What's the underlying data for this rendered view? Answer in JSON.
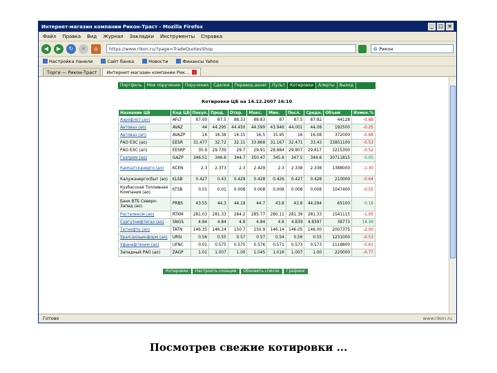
{
  "window": {
    "title": "Интернет-магазин компании Рикон-Траст - Mozilla Firefox",
    "controls": {
      "minimize": "_",
      "maximize": "□",
      "close": "×"
    }
  },
  "menu": [
    "Файл",
    "Правка",
    "Вид",
    "Журнал",
    "Закладки",
    "Инструменты",
    "Справка"
  ],
  "nav": {
    "url": "https://www.rikon.ru/?page=TradeQuotesShop",
    "search_engine": "G",
    "search_value": "Рикон"
  },
  "bookmarks": [
    "Настройка панели",
    "Сайт банка",
    "Новости",
    "Финансы Yahoo"
  ],
  "tabs": [
    {
      "label": "Торги — Рикон-Траст",
      "active": false
    },
    {
      "label": "Интернет-магазин компании Рик...",
      "active": true
    }
  ],
  "status": {
    "left": "Готово",
    "right": "www.rikon.ru"
  },
  "site": {
    "topnav": [
      "Портфель",
      "Мои поручения",
      "Поручения",
      "Сделки",
      "Перевод денег",
      "Пульт",
      "Котировки",
      "Алерты",
      "Выход"
    ],
    "active_tab": "Котировки",
    "quotes_title": "Котировки ЦБ на 14.12.2007 16:10",
    "columns": [
      "Название ЦБ",
      "Код ЦБ",
      "Покуп.",
      "Прод.",
      "Откр.",
      "Макс.",
      "Мин.",
      "Посл.",
      "Средн.",
      "Объем",
      "Измен.%"
    ],
    "rows": [
      {
        "name": "Аэрофлот (ао)",
        "code": "AFLT",
        "buy": "87.00",
        "sell": "87.5",
        "open": "88.33",
        "max": "88.83",
        "min": "87",
        "last": "87.5",
        "avg": "87.82",
        "vol": "44128",
        "chg": "-0.88",
        "link": true
      },
      {
        "name": "Автоваз (ао)",
        "code": "AVAZ",
        "buy": "44",
        "sell": "44.295",
        "open": "44.450",
        "max": "44.599",
        "min": "43.946",
        "last": "44.001",
        "avg": "44.08",
        "vol": "192500",
        "chg": "-0.25",
        "link": true
      },
      {
        "name": "Автоваз (ап)",
        "code": "AVAZP",
        "buy": "16",
        "sell": "16.38",
        "open": "16.15",
        "max": "16.5",
        "min": "15.95",
        "last": "16",
        "avg": "16.08",
        "vol": "372000",
        "chg": "-0.68",
        "link": true
      },
      {
        "name": "РАО ЕЭС (ао)",
        "code": "EESR",
        "buy": "31.477",
        "sell": "32.72",
        "open": "32.11",
        "max": "33.868",
        "min": "31.167",
        "last": "32.471",
        "avg": "33.43",
        "vol": "33851100",
        "chg": "-0.53",
        "link": false
      },
      {
        "name": "РАО ЕЭС (ап)",
        "code": "EESRP",
        "buy": "30.9",
        "sell": "29.739",
        "open": "29.7",
        "max": "29.91",
        "min": "28.884",
        "last": "29.807",
        "avg": "29.817",
        "vol": "3215300",
        "chg": "-0.52",
        "link": false
      },
      {
        "name": "Газпром (ао)",
        "code": "GAZP",
        "buy": "346.51",
        "sell": "346.6",
        "open": "344.7",
        "max": "350.47",
        "min": "345.8",
        "last": "347.5",
        "avg": "344.6",
        "vol": "30711815",
        "chg": "0.05",
        "link": true
      },
      {
        "name": "Камчатскэнерго (ао)",
        "code": "KCEN",
        "buy": "2.3",
        "sell": "2.373",
        "open": "2.3",
        "max": "2.429",
        "min": "2.3",
        "last": "2.338",
        "avg": "2.338",
        "vol": "1388000",
        "chg": "-1.30",
        "link": true,
        "tall": true
      },
      {
        "name": "Калужэнергосбыт (ао)",
        "code": "KLSB",
        "buy": "0.427",
        "sell": "0.43",
        "open": "0.429",
        "max": "0.428",
        "min": "0.426",
        "last": "0.427",
        "avg": "0.428",
        "vol": "210000",
        "chg": "-0.64",
        "link": false
      },
      {
        "name": "Кузбасская Топливная Компания (ао)",
        "code": "KTSB",
        "buy": "0.01",
        "sell": "0.01",
        "open": "0.008",
        "max": "0.008",
        "min": "0.008",
        "last": "0.008",
        "avg": "0.008",
        "vol": "1047400",
        "chg": "-0.55",
        "link": false,
        "tall": true
      },
      {
        "name": "Банк ВТБ Северо-Запад (ао)",
        "code": "PRBS",
        "buy": "43.55",
        "sell": "44.3",
        "open": "44.19",
        "max": "44.7",
        "min": "43.8",
        "last": "43.8",
        "avg": "44.294",
        "vol": "65100",
        "chg": "0.16",
        "link": false,
        "tall": true
      },
      {
        "name": "Ростелеком (ао)",
        "code": "RTKM",
        "buy": "281.03",
        "sell": "281.33",
        "open": "284.2",
        "max": "285.77",
        "min": "280.11",
        "last": "281.39",
        "avg": "281.33",
        "vol": "1541115",
        "chg": "-1.05",
        "link": true
      },
      {
        "name": "Сургутнефтегаз (ао)",
        "code": "SNGS",
        "buy": "4.84",
        "sell": "4.84",
        "open": "4.8",
        "max": "4.84",
        "min": "4.8",
        "last": "4.839",
        "avg": "4.8397",
        "vol": "38773",
        "chg": "14.39",
        "link": true
      },
      {
        "name": "Татнефть (ао)",
        "code": "TATN",
        "buy": "146.35",
        "sell": "146.24",
        "open": "150.7",
        "max": "150.9",
        "min": "146.14",
        "last": "146.05",
        "avg": "146.00",
        "vol": "2007375",
        "chg": "-2.00",
        "link": true
      },
      {
        "name": "Уралсвязьинформ (ао)",
        "code": "URSI",
        "buy": "0.56",
        "sell": "0.55",
        "open": "0.57",
        "max": "0.57",
        "min": "0.54",
        "last": "0.56",
        "avg": "0.55",
        "vol": "1231000",
        "chg": "-0.53",
        "link": true
      },
      {
        "name": "Уфанефтехим (ао)",
        "code": "UFNC",
        "buy": "0.01",
        "sell": "0.575",
        "open": "0.575",
        "max": "0.576",
        "min": "0.571",
        "last": "0.573",
        "avg": "0.573",
        "vol": "2118800",
        "chg": "-0.61",
        "link": true
      },
      {
        "name": "Западный РАО (ао)",
        "code": "ZAGP",
        "buy": "1.01",
        "sell": "1.007",
        "open": "1.00",
        "max": "1.045",
        "min": "1.016",
        "last": "1.007",
        "avg": "1.00",
        "vol": "220000",
        "chg": "-0.77",
        "link": false
      }
    ],
    "pager": [
      "Котировки",
      "Настроить позиции",
      "Обновить список",
      "Графики"
    ]
  },
  "caption": "Посмотрев свежие котировки ..."
}
